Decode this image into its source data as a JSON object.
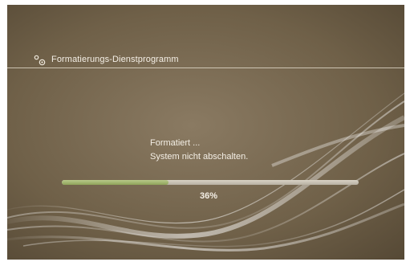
{
  "header": {
    "title": "Formatierungs-Dienstprogramm",
    "icon": "tools-icon"
  },
  "message": {
    "line1": "Formatiert ...",
    "line2": "System nicht abschalten."
  },
  "progress": {
    "value": 0.36,
    "text": "36%"
  },
  "colors": {
    "background": "#6f6048",
    "progress_fill": "#a0b46a",
    "progress_track": "#cfc8ba",
    "text": "#f4efe6",
    "top_banner_text": "#e01818"
  }
}
